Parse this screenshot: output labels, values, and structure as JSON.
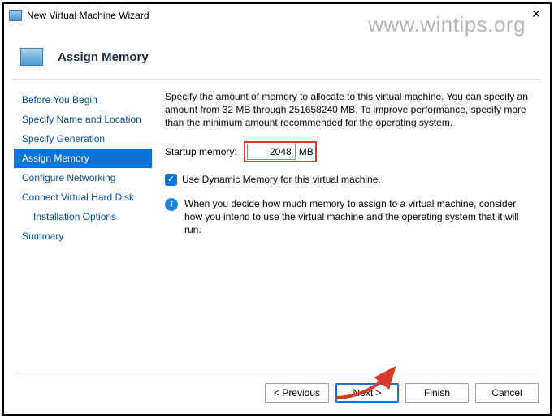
{
  "window": {
    "title": "New Virtual Machine Wizard",
    "watermark": "www.wintips.org"
  },
  "header": {
    "title": "Assign Memory"
  },
  "steps": [
    {
      "label": "Before You Begin",
      "active": false
    },
    {
      "label": "Specify Name and Location",
      "active": false
    },
    {
      "label": "Specify Generation",
      "active": false
    },
    {
      "label": "Assign Memory",
      "active": true
    },
    {
      "label": "Configure Networking",
      "active": false
    },
    {
      "label": "Connect Virtual Hard Disk",
      "active": false
    },
    {
      "label": "Installation Options",
      "active": false,
      "indent": true
    },
    {
      "label": "Summary",
      "active": false
    }
  ],
  "main": {
    "description": "Specify the amount of memory to allocate to this virtual machine. You can specify an amount from 32 MB through 251658240 MB. To improve performance, specify more than the minimum amount recommended for the operating system.",
    "startup_label": "Startup memory:",
    "startup_value": "2048",
    "startup_unit": "MB",
    "dynamic_checked": true,
    "dynamic_label": "Use Dynamic Memory for this virtual machine.",
    "info_text": "When you decide how much memory to assign to a virtual machine, consider how you intend to use the virtual machine and the operating system that it will run."
  },
  "buttons": {
    "previous": "< Previous",
    "next": "Next >",
    "finish": "Finish",
    "cancel": "Cancel"
  }
}
